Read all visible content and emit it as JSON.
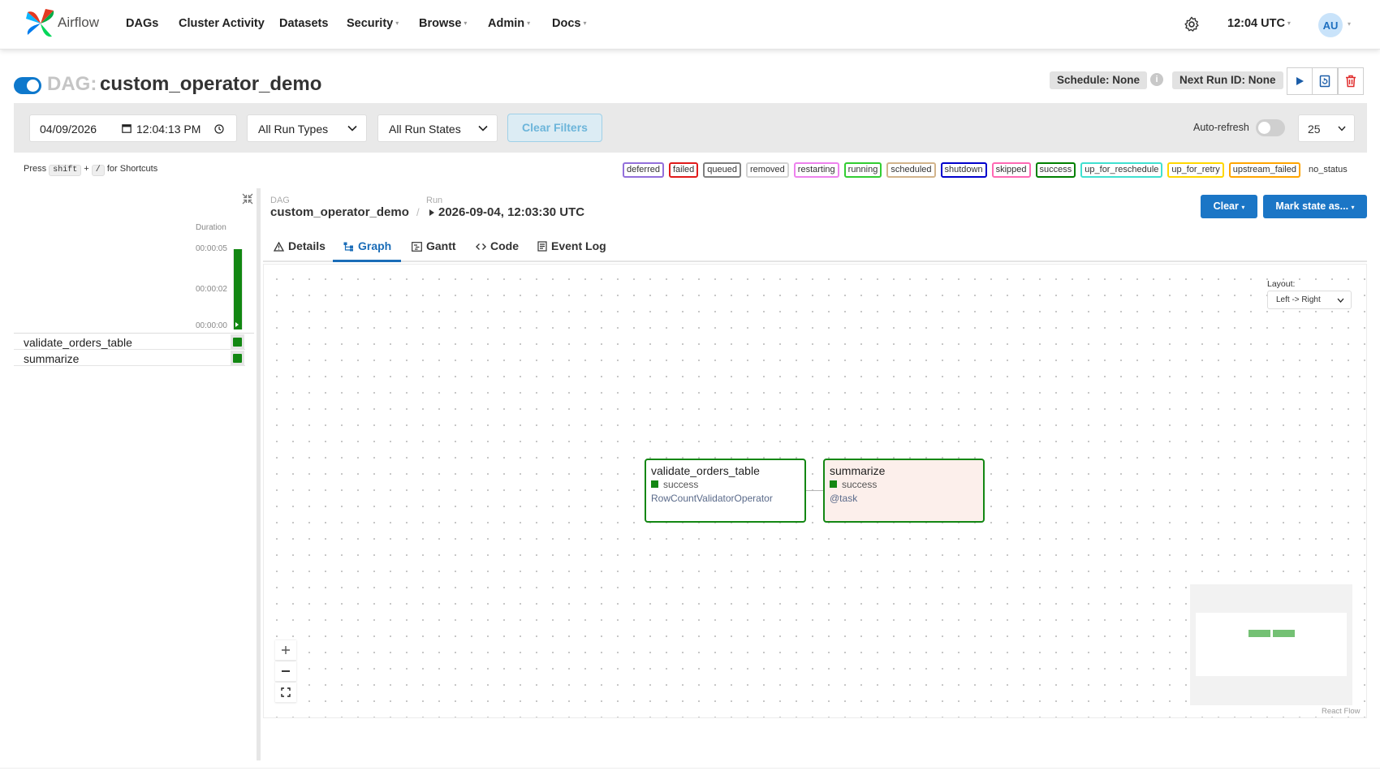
{
  "navbar": {
    "brand": "Airflow",
    "items": [
      {
        "label": "DAGs",
        "dropdown": false
      },
      {
        "label": "Cluster Activity",
        "dropdown": false
      },
      {
        "label": "Datasets",
        "dropdown": false
      },
      {
        "label": "Security",
        "dropdown": true
      },
      {
        "label": "Browse",
        "dropdown": true
      },
      {
        "label": "Admin",
        "dropdown": true
      },
      {
        "label": "Docs",
        "dropdown": true
      }
    ],
    "time": "12:04 UTC",
    "user_initials": "AU",
    "icons": {
      "settings": "gear-icon",
      "logo": "airflow-pinwheel-icon"
    }
  },
  "dag_header": {
    "prefix": "DAG:",
    "dag_id": "custom_operator_demo",
    "paused": false,
    "schedule": "Schedule: None",
    "next_run": "Next Run ID: None"
  },
  "filters": {
    "date": "04/09/2026",
    "time": "12:04:13 PM",
    "run_types": "All Run Types",
    "run_states": "All Run States",
    "clear_filters": "Clear Filters",
    "auto_refresh_label": "Auto-refresh",
    "auto_refresh_on": false,
    "page_size": "25"
  },
  "shortcut_hint": {
    "press": "Press",
    "key1": "shift",
    "plus": "+",
    "key2": "/",
    "suffix": "for Shortcuts"
  },
  "legend": [
    {
      "label": "deferred",
      "color": "#9370db"
    },
    {
      "label": "failed",
      "color": "#e01b1b"
    },
    {
      "label": "queued",
      "color": "#808080"
    },
    {
      "label": "removed",
      "color": "#d3d3d3"
    },
    {
      "label": "restarting",
      "color": "#ee82ee"
    },
    {
      "label": "running",
      "color": "#32cd32"
    },
    {
      "label": "scheduled",
      "color": "#d2b48c"
    },
    {
      "label": "shutdown",
      "color": "#0000cc"
    },
    {
      "label": "skipped",
      "color": "#ff69b4"
    },
    {
      "label": "success",
      "color": "#008000"
    },
    {
      "label": "up_for_reschedule",
      "color": "#40e0d0"
    },
    {
      "label": "up_for_retry",
      "color": "#ffd700"
    },
    {
      "label": "upstream_failed",
      "color": "#ffa500"
    }
  ],
  "legend_no_status": "no_status",
  "grid": {
    "duration_header": "Duration",
    "ticks": [
      "00:00:05",
      "00:00:02",
      "00:00:00"
    ],
    "run_duration_fraction": 1.0,
    "tasks": [
      {
        "name": "validate_orders_table",
        "state": "success"
      },
      {
        "name": "summarize",
        "state": "success"
      }
    ]
  },
  "breadcrumb": {
    "dag_label": "DAG",
    "dag_value": "custom_operator_demo",
    "run_label": "Run",
    "run_value": "2026-09-04, 12:03:30 UTC"
  },
  "actions": {
    "clear": "Clear",
    "mark_state": "Mark state as..."
  },
  "tabs": [
    {
      "label": "Details",
      "icon": "warning-triangle-icon",
      "active": false
    },
    {
      "label": "Graph",
      "icon": "graph-icon",
      "active": true
    },
    {
      "label": "Gantt",
      "icon": "gantt-icon",
      "active": false
    },
    {
      "label": "Code",
      "icon": "code-icon",
      "active": false
    },
    {
      "label": "Event Log",
      "icon": "event-log-icon",
      "active": false
    }
  ],
  "graph": {
    "layout_label": "Layout:",
    "layout_value": "Left -> Right",
    "nodes": [
      {
        "title": "validate_orders_table",
        "state": "success",
        "operator": "RowCountValidatorOperator"
      },
      {
        "title": "summarize",
        "state": "success",
        "operator": "@task"
      }
    ],
    "attribution": "React Flow"
  }
}
